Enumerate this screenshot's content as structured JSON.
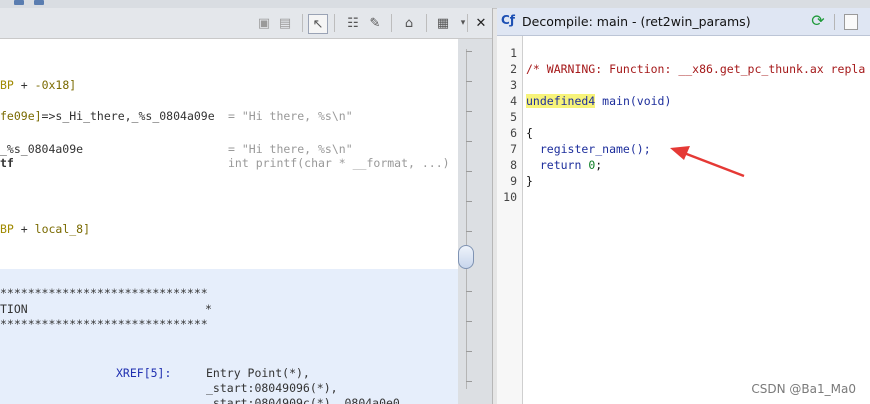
{
  "listing": {
    "lines": [
      {
        "a": "BP",
        "b": " + ",
        "c": "-0x18]",
        "d": ""
      },
      {
        "a": "fe09e]",
        "b": "=>s_Hi_there,_%s_0804a09e",
        "c": "",
        "d": "= \"Hi there, %s\\n\""
      },
      {
        "a": "_%s_0804a09e",
        "b": "",
        "c": "",
        "d": "= \"Hi there, %s\\n\""
      },
      {
        "a": "tf",
        "b": "",
        "c": "",
        "d": "int printf(char * __format, ...)"
      },
      {
        "a": "BP",
        "b": " + ",
        "c": "local_8]",
        "d": ""
      }
    ],
    "stars1": "******************************",
    "func_label": "TION",
    "star_end": "*",
    "stars2": "******************************",
    "xref_label": "XREF[5]:",
    "xrefs": [
      "Entry Point(*),",
      "_start:08049096(*),",
      "_start:0804909c(*), 0804a0e0"
    ]
  },
  "decompile": {
    "title": "Decompile: main - (ret2win_params)",
    "line_numbers": [
      "1",
      "2",
      "3",
      "4",
      "5",
      "6",
      "7",
      "8",
      "9",
      "10"
    ],
    "code": {
      "comment": "/* WARNING: Function: __x86.get_pc_thunk.ax repla",
      "ret_type": "undefined4",
      "fn_sig": " main(void)",
      "open_brace": "{",
      "call": "  register_name();",
      "ret_kw": "  return ",
      "ret_val": "0",
      "ret_end": ";",
      "close_brace": "}"
    }
  },
  "watermark": "CSDN @Ba1_Ma0",
  "colors": {
    "arrow": "#e53935",
    "highlight": "#f7f37a",
    "comment": "#a5191a"
  }
}
